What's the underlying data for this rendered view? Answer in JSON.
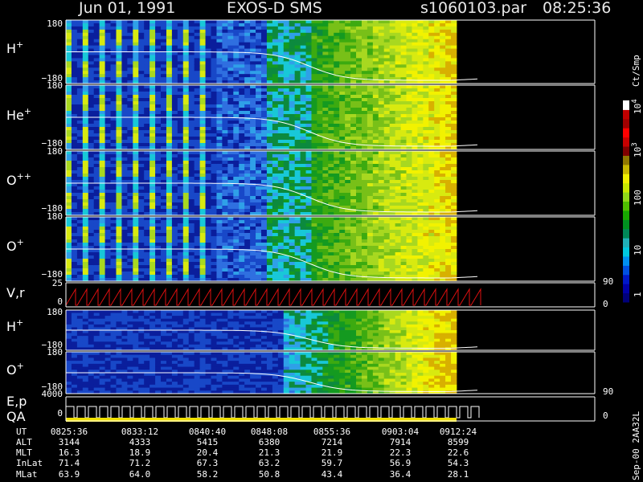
{
  "header": {
    "date": "Jun 01, 1991",
    "instrument": "EXOS-D SMS",
    "file": "s1060103.par",
    "time": "08:25:36"
  },
  "colorbar": {
    "unit_label": "Ct/Smp",
    "tick_labels": [
      "1",
      "10",
      "100",
      "10",
      "10"
    ],
    "tick_exponents": [
      "",
      "",
      "",
      "3",
      "4"
    ],
    "colors": [
      "#00007a",
      "#0000a8",
      "#0018c8",
      "#0050e0",
      "#0090f0",
      "#00c8e0",
      "#20b0b8",
      "#008858",
      "#009020",
      "#18a800",
      "#50c000",
      "#90d818",
      "#c8e800",
      "#f0f000",
      "#c8b800",
      "#907800",
      "#800000",
      "#c80000",
      "#ff0000",
      "#a00000",
      "#c00000",
      "#ffffff"
    ]
  },
  "footer_code": "Sep-00  2AA32L",
  "chart_data": {
    "type": "heatmap",
    "panels": [
      {
        "label": "H",
        "charge": "+",
        "ymax": "180",
        "ymin": "−180"
      },
      {
        "label": "He",
        "charge": "+",
        "ymax": "180",
        "ymin": "−180"
      },
      {
        "label": "O",
        "charge": "++",
        "ymax": "180",
        "ymin": "−180"
      },
      {
        "label": "O",
        "charge": "+",
        "ymax": "180",
        "ymin": "−180"
      },
      {
        "label": "V,r",
        "charge": "",
        "ymax": "25",
        "ymin": "0",
        "right_top": "90",
        "right_bottom": "0"
      },
      {
        "label": "H",
        "charge": "+",
        "ymax": "180",
        "ymin": "−180"
      },
      {
        "label": "O",
        "charge": "+",
        "ymax": "180",
        "ymin": "−180"
      },
      {
        "label": "E,p",
        "label2": "QA",
        "charge": "",
        "ymax": "4000",
        "ymin": "0",
        "right_top": "90",
        "right_bottom": "0"
      }
    ],
    "ephemeris": {
      "row_labels": [
        "UT",
        "ALT",
        "MLT",
        "InLat",
        "MLat"
      ],
      "columns": [
        {
          "UT": "0825:36",
          "ALT": "3144",
          "MLT": "16.3",
          "InLat": "71.4",
          "MLat": "63.9"
        },
        {
          "UT": "0833:12",
          "ALT": "4333",
          "MLT": "18.9",
          "InLat": "71.2",
          "MLat": "64.0"
        },
        {
          "UT": "0840:40",
          "ALT": "5415",
          "MLT": "20.4",
          "InLat": "67.3",
          "MLat": "58.2"
        },
        {
          "UT": "0848:08",
          "ALT": "6380",
          "MLT": "21.3",
          "InLat": "63.2",
          "MLat": "50.8"
        },
        {
          "UT": "0855:36",
          "ALT": "7214",
          "MLT": "21.9",
          "InLat": "59.7",
          "MLat": "43.4"
        },
        {
          "UT": "0903:04",
          "ALT": "7914",
          "MLT": "22.3",
          "InLat": "56.9",
          "MLat": "36.4"
        },
        {
          "UT": "0912:24",
          "ALT": "8599",
          "MLT": "22.6",
          "InLat": "54.3",
          "MLat": "28.1"
        }
      ]
    }
  }
}
